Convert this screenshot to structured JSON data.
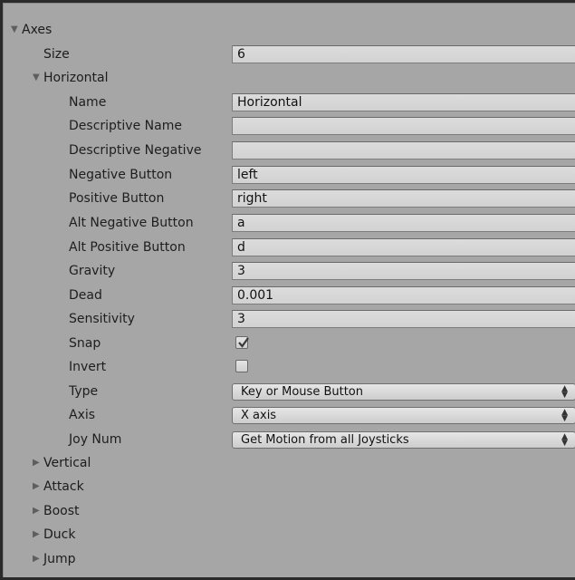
{
  "axes": {
    "label": "Axes",
    "size_label": "Size",
    "size_value": "6",
    "horizontal": {
      "label": "Horizontal",
      "fields": [
        {
          "label": "Name",
          "value": "Horizontal"
        },
        {
          "label": "Descriptive Name",
          "value": ""
        },
        {
          "label": "Descriptive Negative",
          "value": ""
        },
        {
          "label": "Negative Button",
          "value": "left"
        },
        {
          "label": "Positive Button",
          "value": "right"
        },
        {
          "label": "Alt Negative Button",
          "value": "a"
        },
        {
          "label": "Alt Positive Button",
          "value": "d"
        },
        {
          "label": "Gravity",
          "value": "3"
        },
        {
          "label": "Dead",
          "value": "0.001"
        },
        {
          "label": "Sensitivity",
          "value": "3"
        }
      ],
      "snap": {
        "label": "Snap",
        "checked": true
      },
      "invert": {
        "label": "Invert",
        "checked": false
      },
      "type": {
        "label": "Type",
        "value": "Key or Mouse Button"
      },
      "axis": {
        "label": "Axis",
        "value": "X axis"
      },
      "joy_num": {
        "label": "Joy Num",
        "value": "Get Motion from all Joysticks"
      }
    },
    "collapsed": [
      "Vertical",
      "Attack",
      "Boost",
      "Duck",
      "Jump"
    ]
  },
  "icons": {
    "expanded": "triangle-down-icon",
    "collapsed": "triangle-right-icon",
    "select_arrows": "updown-arrows-icon",
    "check": "checkmark-icon"
  }
}
